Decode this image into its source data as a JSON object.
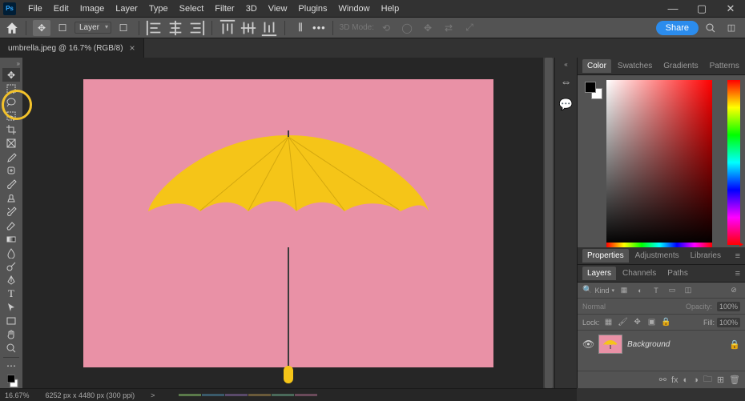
{
  "menubar": {
    "logo": "Ps",
    "items": [
      "File",
      "Edit",
      "Image",
      "Layer",
      "Type",
      "Select",
      "Filter",
      "3D",
      "View",
      "Plugins",
      "Window",
      "Help"
    ]
  },
  "optbar": {
    "layer_select": "Layer",
    "mode_label": "3D Mode:",
    "share": "Share"
  },
  "tab": {
    "title": "umbrella.jpeg @ 16.7% (RGB/8)",
    "close": "×"
  },
  "colors": {
    "canvas_bg": "#e991a6",
    "accent_share": "#2b8ced",
    "highlight": "#f3c22b",
    "umbrella": "#f5c518"
  },
  "panels": {
    "color": {
      "tabs": [
        "Color",
        "Swatches",
        "Gradients",
        "Patterns"
      ],
      "active": 0
    },
    "props": {
      "tabs": [
        "Properties",
        "Adjustments",
        "Libraries"
      ],
      "active": 0
    },
    "layers": {
      "tabs": [
        "Layers",
        "Channels",
        "Paths"
      ],
      "active": 0,
      "kind": "Kind",
      "blend_mode": "Normal",
      "opacity_label": "Opacity:",
      "opacity_value": "100%",
      "lock_label": "Lock:",
      "fill_label": "Fill:",
      "fill_value": "100%",
      "layer_name": "Background"
    }
  },
  "status": {
    "zoom": "16.67%",
    "doc": "6252 px x 4480 px (300 ppi)",
    "arrow": ">"
  }
}
